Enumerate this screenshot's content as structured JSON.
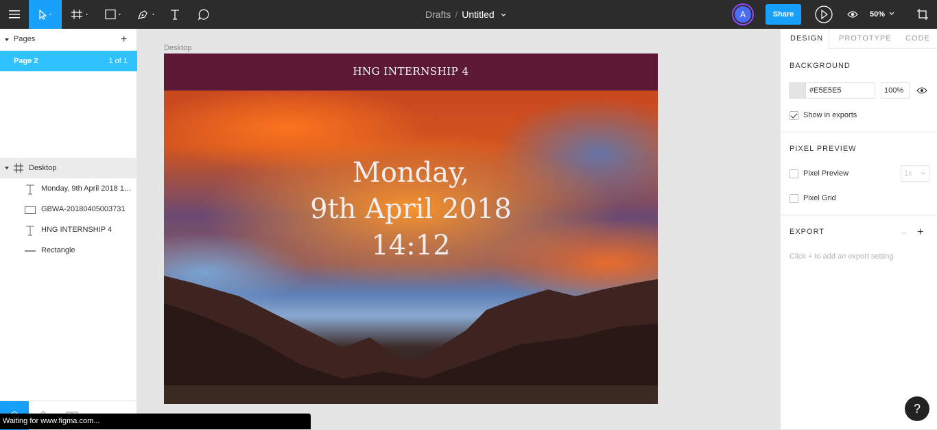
{
  "toolbar": {
    "breadcrumb_folder": "Drafts",
    "breadcrumb_separator": "/",
    "file_name": "Untitled",
    "avatar_initial": "A",
    "share_label": "Share",
    "zoom_level": "50%",
    "accent_color": "#18a0fb"
  },
  "pages": {
    "header": "Pages",
    "items": [
      {
        "name": "Page 2",
        "count": "1 of 1"
      }
    ]
  },
  "layers": {
    "root": "Desktop",
    "items": [
      {
        "name": "Monday, 9th April 2018 14:12",
        "icon": "text-icon"
      },
      {
        "name": "GBWA-20180405003731",
        "icon": "image-icon"
      },
      {
        "name": "HNG INTERNSHIP 4",
        "icon": "text-icon"
      },
      {
        "name": "Rectangle",
        "icon": "line-icon"
      }
    ]
  },
  "status_bar": "Waiting for www.figma.com...",
  "canvas": {
    "frame_label": "Desktop",
    "header_title": "HNG INTERNSHIP 4",
    "header_color": "#5c1935",
    "date_line1": "Monday,",
    "date_line2": "9th April 2018",
    "time_line": "14:12"
  },
  "right_panel": {
    "tabs": [
      "DESIGN",
      "PROTOTYPE",
      "CODE"
    ],
    "background": {
      "title": "BACKGROUND",
      "hex": "#E5E5E5",
      "opacity": "100%",
      "show_in_exports": "Show in exports"
    },
    "pixel_preview": {
      "title": "PIXEL PREVIEW",
      "preview_label": "Pixel Preview",
      "preview_scale": "1x",
      "grid_label": "Pixel Grid"
    },
    "export": {
      "title": "EXPORT",
      "hint": "Click + to add an export setting"
    },
    "help": "?"
  }
}
